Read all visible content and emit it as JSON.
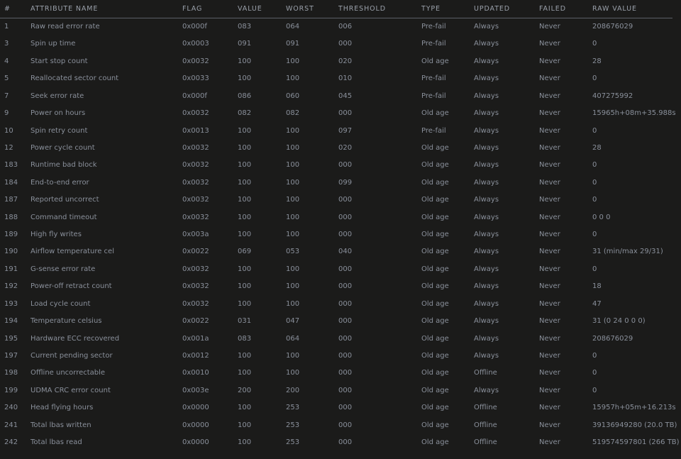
{
  "table": {
    "headers": [
      "#",
      "ATTRIBUTE NAME",
      "FLAG",
      "VALUE",
      "WORST",
      "THRESHOLD",
      "TYPE",
      "UPDATED",
      "FAILED",
      "RAW VALUE"
    ],
    "rows": [
      [
        "1",
        "Raw read error rate",
        "0x000f",
        "083",
        "064",
        "006",
        "Pre-fail",
        "Always",
        "Never",
        "208676029"
      ],
      [
        "3",
        "Spin up time",
        "0x0003",
        "091",
        "091",
        "000",
        "Pre-fail",
        "Always",
        "Never",
        "0"
      ],
      [
        "4",
        "Start stop count",
        "0x0032",
        "100",
        "100",
        "020",
        "Old age",
        "Always",
        "Never",
        "28"
      ],
      [
        "5",
        "Reallocated sector count",
        "0x0033",
        "100",
        "100",
        "010",
        "Pre-fail",
        "Always",
        "Never",
        "0"
      ],
      [
        "7",
        "Seek error rate",
        "0x000f",
        "086",
        "060",
        "045",
        "Pre-fail",
        "Always",
        "Never",
        "407275992"
      ],
      [
        "9",
        "Power on hours",
        "0x0032",
        "082",
        "082",
        "000",
        "Old age",
        "Always",
        "Never",
        "15965h+08m+35.988s"
      ],
      [
        "10",
        "Spin retry count",
        "0x0013",
        "100",
        "100",
        "097",
        "Pre-fail",
        "Always",
        "Never",
        "0"
      ],
      [
        "12",
        "Power cycle count",
        "0x0032",
        "100",
        "100",
        "020",
        "Old age",
        "Always",
        "Never",
        "28"
      ],
      [
        "183",
        "Runtime bad block",
        "0x0032",
        "100",
        "100",
        "000",
        "Old age",
        "Always",
        "Never",
        "0"
      ],
      [
        "184",
        "End-to-end error",
        "0x0032",
        "100",
        "100",
        "099",
        "Old age",
        "Always",
        "Never",
        "0"
      ],
      [
        "187",
        "Reported uncorrect",
        "0x0032",
        "100",
        "100",
        "000",
        "Old age",
        "Always",
        "Never",
        "0"
      ],
      [
        "188",
        "Command timeout",
        "0x0032",
        "100",
        "100",
        "000",
        "Old age",
        "Always",
        "Never",
        "0 0 0"
      ],
      [
        "189",
        "High fly writes",
        "0x003a",
        "100",
        "100",
        "000",
        "Old age",
        "Always",
        "Never",
        "0"
      ],
      [
        "190",
        "Airflow temperature cel",
        "0x0022",
        "069",
        "053",
        "040",
        "Old age",
        "Always",
        "Never",
        "31 (min/max 29/31)"
      ],
      [
        "191",
        "G-sense error rate",
        "0x0032",
        "100",
        "100",
        "000",
        "Old age",
        "Always",
        "Never",
        "0"
      ],
      [
        "192",
        "Power-off retract count",
        "0x0032",
        "100",
        "100",
        "000",
        "Old age",
        "Always",
        "Never",
        "18"
      ],
      [
        "193",
        "Load cycle count",
        "0x0032",
        "100",
        "100",
        "000",
        "Old age",
        "Always",
        "Never",
        "47"
      ],
      [
        "194",
        "Temperature celsius",
        "0x0022",
        "031",
        "047",
        "000",
        "Old age",
        "Always",
        "Never",
        "31 (0 24 0 0 0)"
      ],
      [
        "195",
        "Hardware ECC recovered",
        "0x001a",
        "083",
        "064",
        "000",
        "Old age",
        "Always",
        "Never",
        "208676029"
      ],
      [
        "197",
        "Current pending sector",
        "0x0012",
        "100",
        "100",
        "000",
        "Old age",
        "Always",
        "Never",
        "0"
      ],
      [
        "198",
        "Offline uncorrectable",
        "0x0010",
        "100",
        "100",
        "000",
        "Old age",
        "Offline",
        "Never",
        "0"
      ],
      [
        "199",
        "UDMA CRC error count",
        "0x003e",
        "200",
        "200",
        "000",
        "Old age",
        "Always",
        "Never",
        "0"
      ],
      [
        "240",
        "Head flying hours",
        "0x0000",
        "100",
        "253",
        "000",
        "Old age",
        "Offline",
        "Never",
        "15957h+05m+16.213s"
      ],
      [
        "241",
        "Total lbas written",
        "0x0000",
        "100",
        "253",
        "000",
        "Old age",
        "Offline",
        "Never",
        "39136949280 (20.0 TB)"
      ],
      [
        "242",
        "Total lbas read",
        "0x0000",
        "100",
        "253",
        "000",
        "Old age",
        "Offline",
        "Never",
        "519574597801 (266 TB)"
      ]
    ]
  }
}
